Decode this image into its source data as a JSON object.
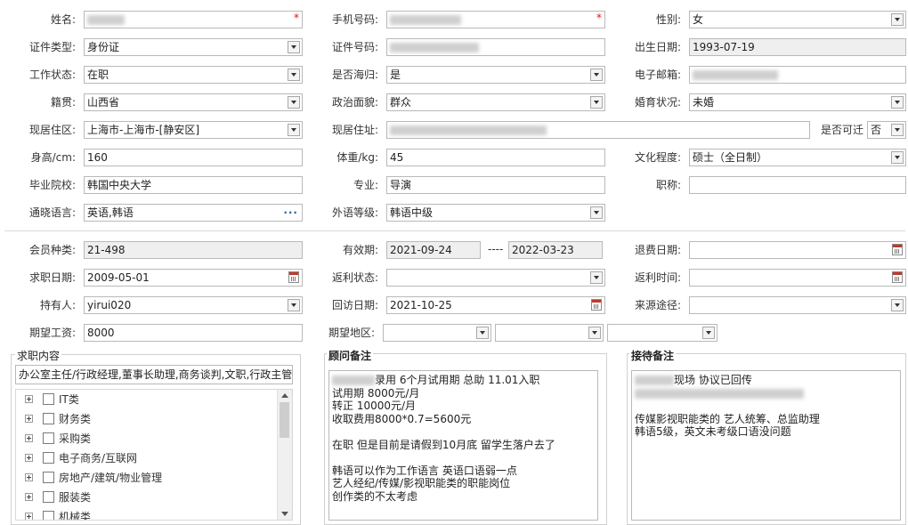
{
  "form": {
    "name": {
      "label": "姓名:",
      "value": ""
    },
    "mobile": {
      "label": "手机号码:",
      "value": ""
    },
    "gender": {
      "label": "性别:",
      "value": "女"
    },
    "id_type": {
      "label": "证件类型:",
      "value": "身份证"
    },
    "id_number": {
      "label": "证件号码:",
      "value": ""
    },
    "birth_date": {
      "label": "出生日期:",
      "value": "1993-07-19"
    },
    "work_status": {
      "label": "工作状态:",
      "value": "在职"
    },
    "returnee": {
      "label": "是否海归:",
      "value": "是"
    },
    "email": {
      "label": "电子邮箱:",
      "value": ""
    },
    "native_place": {
      "label": "籍贯:",
      "value": "山西省"
    },
    "political": {
      "label": "政治面貌:",
      "value": "群众"
    },
    "marital": {
      "label": "婚育状况:",
      "value": "未婚"
    },
    "residence_area": {
      "label": "现居住区:",
      "value": "上海市-上海市-[静安区]"
    },
    "address": {
      "label": "现居住址:",
      "value": ""
    },
    "relocate": {
      "label": "是否可迁",
      "value": "否"
    },
    "height": {
      "label": "身高/cm:",
      "value": "160"
    },
    "weight": {
      "label": "体重/kg:",
      "value": "45"
    },
    "education": {
      "label": "文化程度:",
      "value": "硕士（全日制）"
    },
    "school": {
      "label": "毕业院校:",
      "value": "韩国中央大学"
    },
    "major": {
      "label": "专业:",
      "value": "导演"
    },
    "title": {
      "label": "职称:",
      "value": ""
    },
    "languages": {
      "label": "通晓语言:",
      "value": "英语,韩语"
    },
    "language_level": {
      "label": "外语等级:",
      "value": "韩语中级"
    },
    "member_type": {
      "label": "会员种类:",
      "value": "21-498"
    },
    "valid_period": {
      "label": "有效期:",
      "start": "2021-09-24",
      "sep": "----",
      "end": "2022-03-23"
    },
    "refund_date": {
      "label": "退费日期:",
      "value": ""
    },
    "job_date": {
      "label": "求职日期:",
      "value": "2009-05-01"
    },
    "rebate_status": {
      "label": "返利状态:",
      "value": ""
    },
    "rebate_time": {
      "label": "返利时间:",
      "value": ""
    },
    "holder": {
      "label": "持有人:",
      "value": "yirui020"
    },
    "visit_date": {
      "label": "回访日期:",
      "value": "2021-10-25"
    },
    "source": {
      "label": "来源途径:",
      "value": ""
    },
    "expected_salary": {
      "label": "期望工资:",
      "value": "8000"
    },
    "expected_area": {
      "label": "期望地区:",
      "values": [
        "",
        "",
        ""
      ]
    }
  },
  "job_content": {
    "title": "求职内容",
    "selected": "办公室主任/行政经理,董事长助理,商务谈判,文职,行政主管",
    "categories": [
      "IT类",
      "财务类",
      "采购类",
      "电子商务/互联网",
      "房地产/建筑/物业管理",
      "服装类",
      "机械类"
    ]
  },
  "advisor_notes": {
    "title": "顾问备注",
    "lines": [
      "录用  6个月试用期  总助  11.01入职",
      "试用期 8000元/月",
      "转正 10000元/月",
      "收取费用8000*0.7=5600元",
      "",
      "在职  但是目前是请假到10月底  留学生落户去了",
      "",
      "韩语可以作为工作语言  英语口语弱一点",
      "艺人经纪/传媒/影视职能类的职能岗位",
      "创作类的不太考虑"
    ]
  },
  "reception_notes": {
    "title": "接待备注",
    "lines": [
      "现场 协议已回传",
      "",
      "",
      "传媒影视职能类的 艺人统筹、总监助理",
      "韩语5级，英文未考级口语没问题"
    ]
  },
  "colors": {
    "border": "#b9b9b9",
    "readonly_bg": "#efefef",
    "required": "#dd1111",
    "link": "#2a5fb0"
  }
}
